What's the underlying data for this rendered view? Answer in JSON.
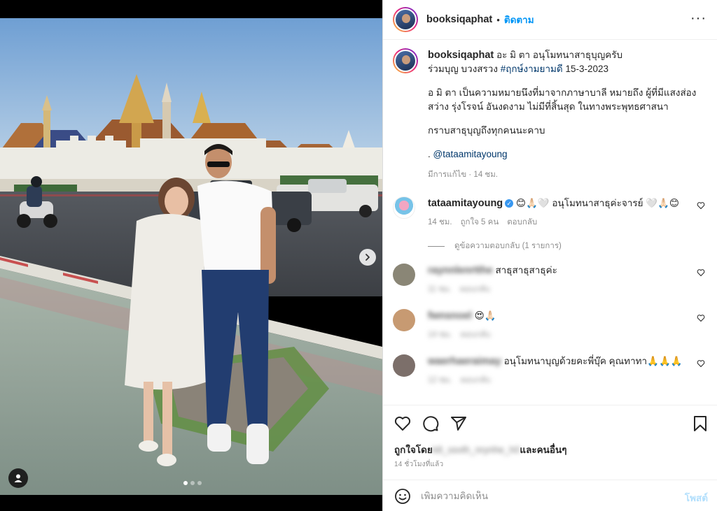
{
  "post": {
    "author": "booksiqaphat",
    "separator": "•",
    "follow_label": "ติดตาม",
    "more_label": "···"
  },
  "caption": {
    "username": "booksiqaphat",
    "line1_text": " อะ มิ ตา อนุโมทนาสาธุบุญครับ",
    "line2_prefix": "ร่วมบุญ บวงสรวง ",
    "hashtag": "#ฤกษ์งามยามดี",
    "line2_suffix": " 15-3-2023",
    "paragraph2": "อ มิ ตา เป็นความหมายนึงที่มาจากภาษาบาลี หมายถึง ผู้ที่มีแสงส่อง สว่าง รุ่งโรจน์ อันงดงาม ไม่มีที่สิ้นสุด ในทางพระพุทธศาสนา",
    "paragraph3": "กราบสาธุบุญถึงทุกคนนะคาบ",
    "mention_prefix": ". ",
    "mention": "@tataamitayoung",
    "meta": "มีการแก้ไข · 14 ชม."
  },
  "comments": [
    {
      "username": "tataamitayoung",
      "verified_mark": "✓",
      "text": " 😊🙏🏻🤍 อนุโมทนาสาธุค่ะจารย์ 🤍🙏🏻😊",
      "time": "14 ชม.",
      "likes": "ถูกใจ 5 คน",
      "reply": "ตอบกลับ",
      "view_replies": "ดูข้อความตอบกลับ (1 รายการ)"
    },
    {
      "username": "raynnlenrtthe",
      "text": "สาธุสาธุสาธุค่ะ",
      "time": "11 ชม.",
      "reply": "ตอบกลับ"
    },
    {
      "username": "fwnsnoel",
      "text": "😍🙏🏻",
      "time": "14 ชม.",
      "reply": "ตอบกลับ"
    },
    {
      "username": "waerhaeraimay",
      "text": "อนุโมทนาบุญด้วยคะพี่บุ๊ค คุณทาทา🙏🙏🙏",
      "time": "12 ชม.",
      "reply": "ตอบกลับ"
    }
  ],
  "likes": {
    "prefix": "ถูกใจโดย",
    "blurred_user": "k8_ssvth_nrynhe_h0",
    "suffix": "และคนอื่นๆ"
  },
  "time_ago": "14 ชั่วโมงที่แล้ว",
  "add_comment": {
    "placeholder": "เพิ่มความคิดเห็น",
    "post_label": "โพสต์"
  },
  "icons": [
    "more-icon",
    "heart-icon",
    "comment-icon",
    "share-icon",
    "bookmark-icon",
    "emoji-icon",
    "chevron-right-icon",
    "user-tag-icon"
  ],
  "carousel": {
    "slides": 3,
    "active_index": 0
  },
  "colors": {
    "accent": "#0095f6",
    "text": "#262626",
    "muted": "#8e8e8e",
    "link": "#00376b",
    "post_disabled": "#b2dffc"
  }
}
